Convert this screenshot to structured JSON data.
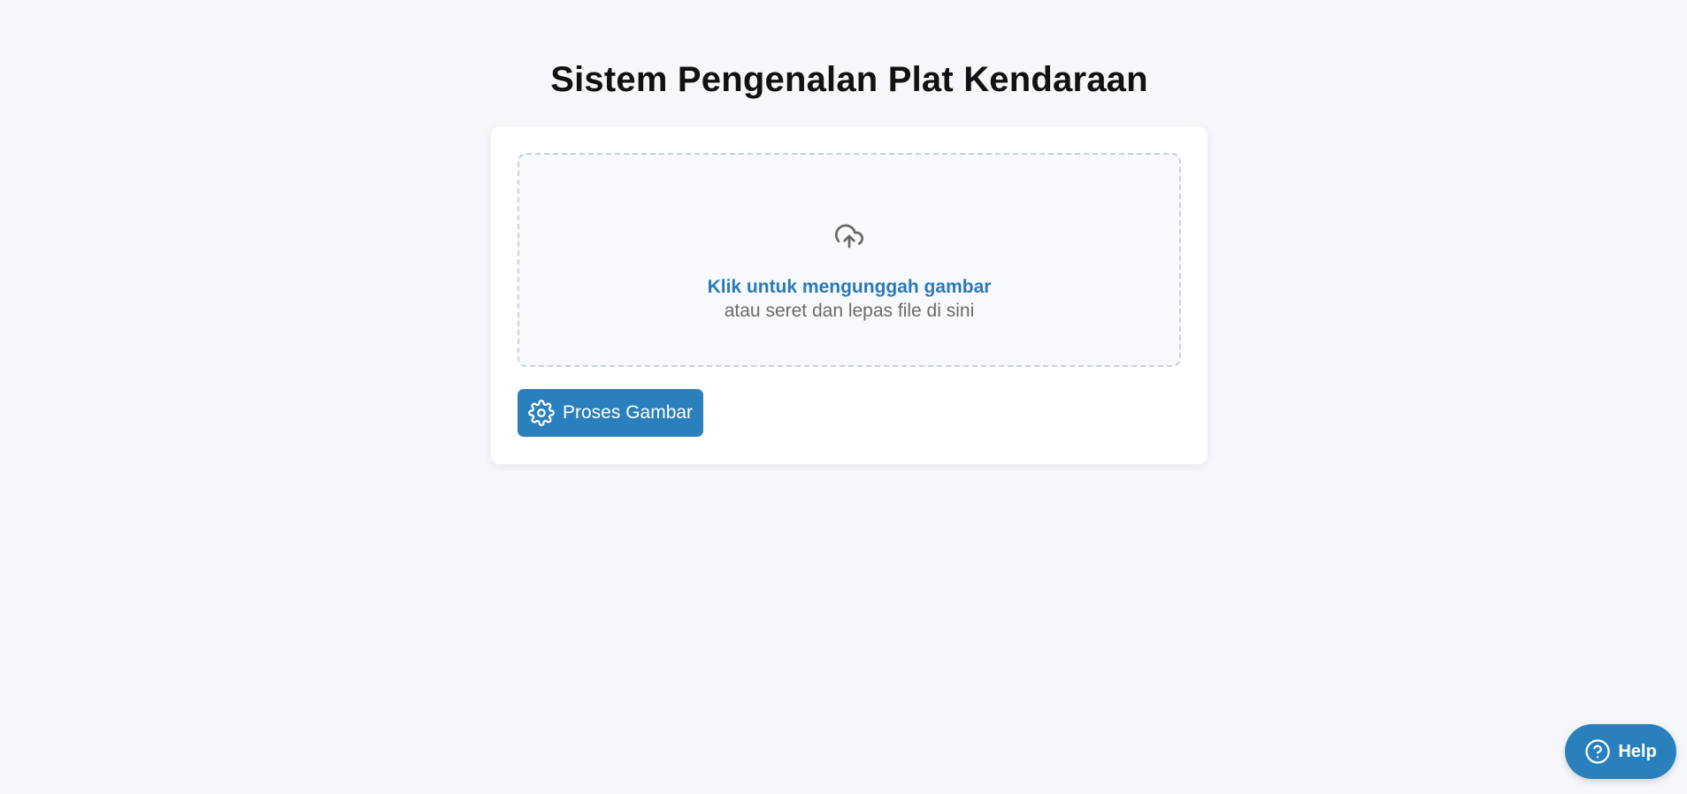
{
  "page": {
    "title": "Sistem Pengenalan Plat Kendaraan"
  },
  "upload": {
    "primary_text": "Klik untuk mengunggah gambar",
    "secondary_text": "atau seret dan lepas file di sini",
    "icon": "cloud-upload-icon"
  },
  "actions": {
    "process_label": "Proses Gambar",
    "process_icon": "gear-icon"
  },
  "help": {
    "label": "Help",
    "icon": "question-circle-icon"
  },
  "colors": {
    "accent": "#2a80bc",
    "link": "#2a7ab9",
    "background": "#f5f7fb",
    "card": "#ffffff"
  }
}
